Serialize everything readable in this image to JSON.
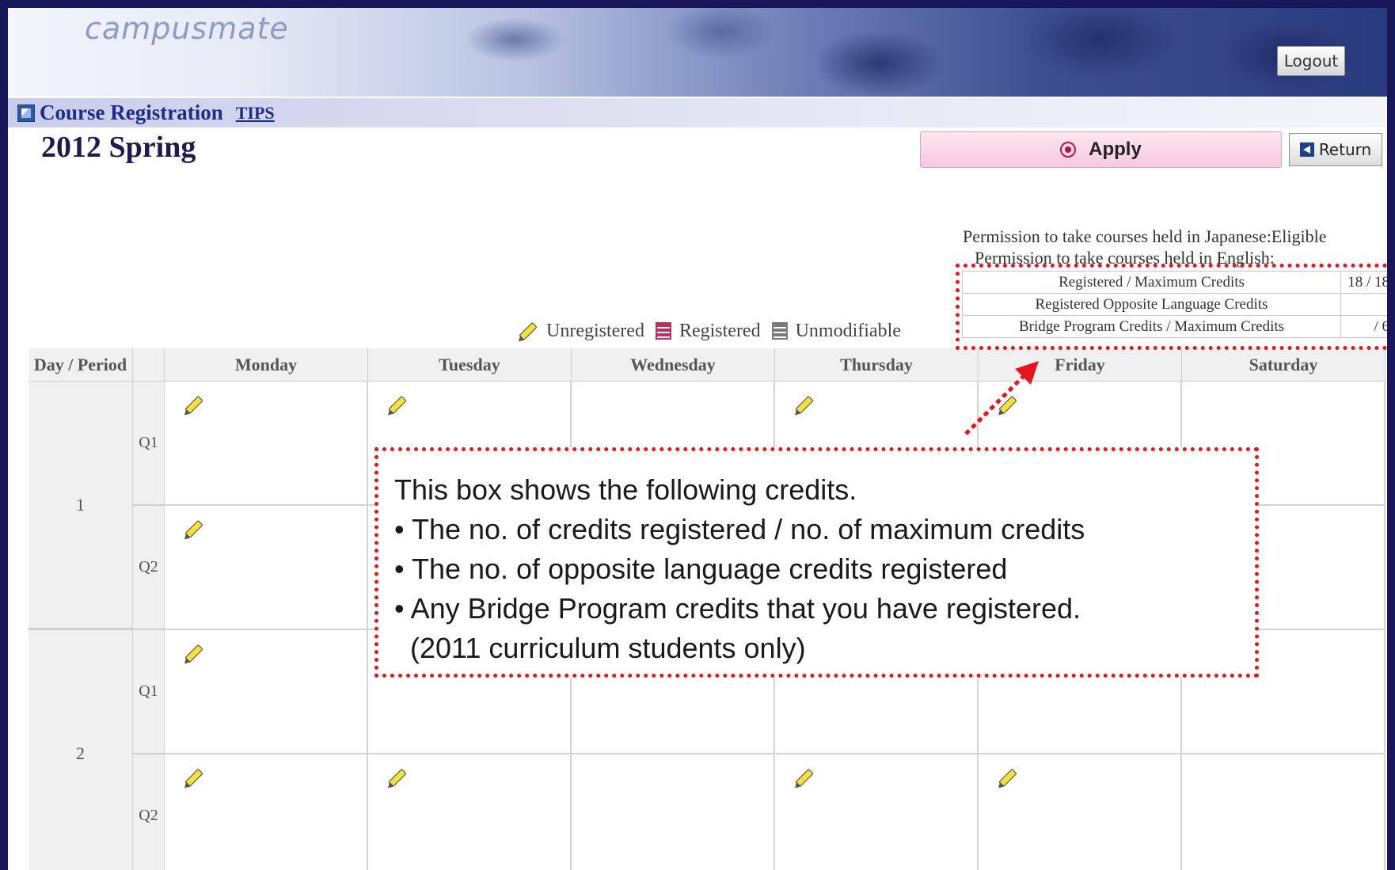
{
  "header": {
    "logo_text": "campusmate",
    "logout_label": "Logout"
  },
  "menu": {
    "title": "Course Registration",
    "tips_label": "TIPS"
  },
  "page": {
    "term": "2012 Spring",
    "apply_label": "Apply",
    "return_label": "Return"
  },
  "permissions": {
    "japanese": "Permission to take courses held in Japanese:Eligible",
    "english": "Permission to take courses held in English:"
  },
  "credits": [
    {
      "label": "Registered / Maximum Credits",
      "value": "18 / 18"
    },
    {
      "label": "Registered Opposite Language Credits",
      "value": ""
    },
    {
      "label": "Bridge Program Credits / Maximum Credits",
      "value": "/ 6"
    }
  ],
  "legend": {
    "unregistered": "Unregistered",
    "registered": "Registered",
    "unmodifiable": "Unmodifiable"
  },
  "timetable": {
    "corner_label": "Day / Period",
    "days": [
      "Monday",
      "Tuesday",
      "Wednesday",
      "Thursday",
      "Friday",
      "Saturday"
    ],
    "periods": [
      {
        "label": "1",
        "quarters": [
          {
            "label": "Q1",
            "pencils": [
              true,
              true,
              false,
              true,
              true,
              false
            ]
          },
          {
            "label": "Q2",
            "pencils": [
              true,
              false,
              false,
              false,
              false,
              false
            ]
          }
        ]
      },
      {
        "label": "2",
        "quarters": [
          {
            "label": "Q1",
            "pencils": [
              true,
              false,
              false,
              false,
              false,
              false
            ]
          },
          {
            "label": "Q2",
            "pencils": [
              true,
              true,
              false,
              true,
              true,
              false
            ]
          }
        ]
      }
    ]
  },
  "callout": {
    "lines": [
      "This box shows the following credits.",
      "• The no. of credits registered / no. of maximum credits",
      "• The no. of opposite language credits registered",
      "• Any Bridge Program credits that you have registered.",
      "  (2011 curriculum students only)"
    ]
  },
  "colors": {
    "annotation_red": "#e8141c",
    "title_blue": "#1d2c88",
    "apply_pink": "#f5c9de"
  }
}
